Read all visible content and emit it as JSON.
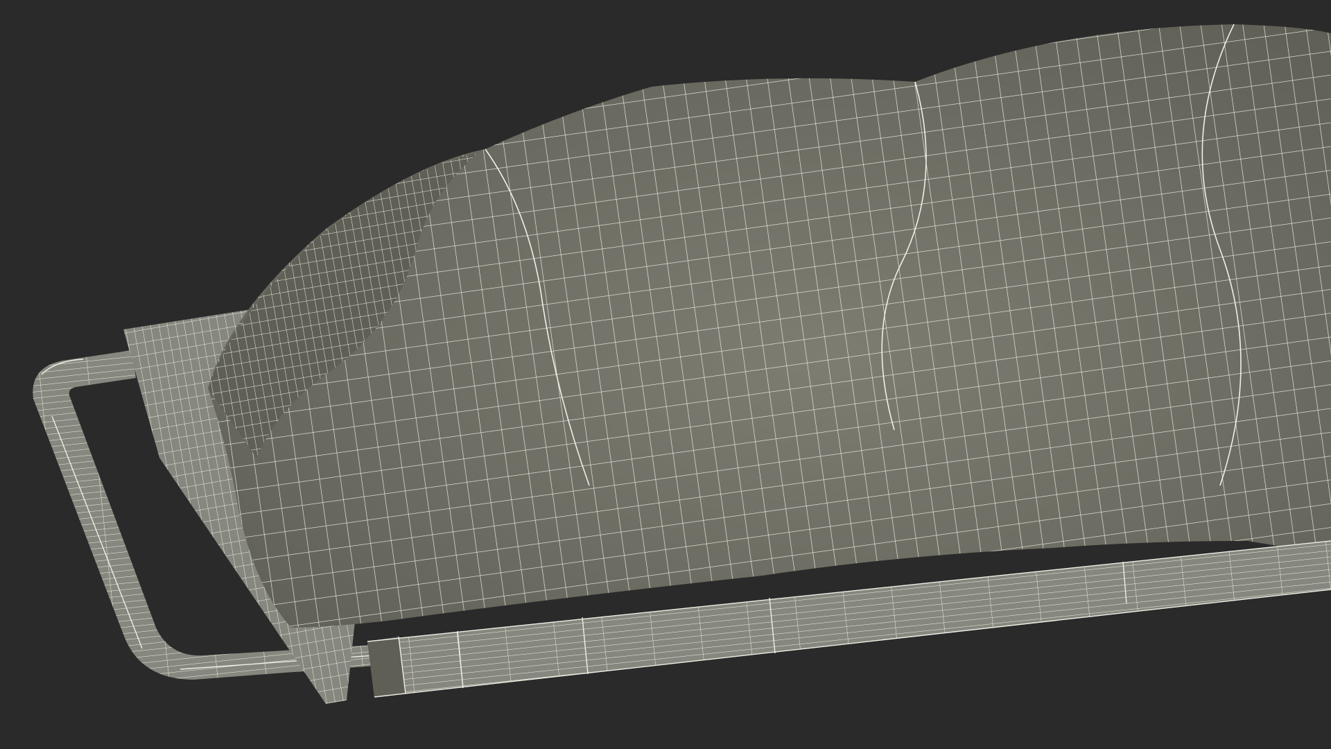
{
  "scene": {
    "background_color": "#2a2a2a",
    "surface_color": "#7d7d72",
    "surface_shadow_color": "#5f5f56",
    "wire_color": "#f1efe6",
    "frame_color": "#86877e"
  }
}
